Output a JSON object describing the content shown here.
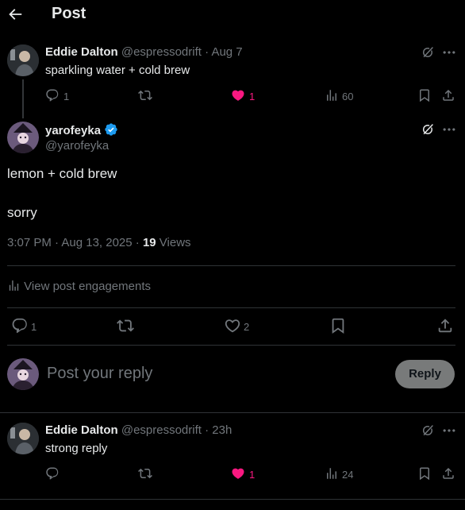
{
  "header": {
    "title": "Post",
    "back_icon": "arrow-left-icon"
  },
  "colors": {
    "background": "#000000",
    "text": "#e7e9ea",
    "muted": "#71767b",
    "like_active": "#f91880",
    "verified": "#1d9bf0",
    "reply_button_bg": "#787a7a"
  },
  "parent_post": {
    "display_name": "Eddie Dalton",
    "meta": "@espressodrift · Aug 7",
    "text": "sparkling water + cold brew",
    "replies": "1",
    "likes": "1",
    "views": "60"
  },
  "main_post": {
    "display_name": "yarofeyka",
    "handle": "@yarofeyka",
    "line1": "lemon + cold brew",
    "line2": "sorry",
    "timestamp": "3:07 PM · Aug 13, 2025 · ",
    "views_count": "19",
    "views_label": " Views",
    "engagements_label": "View post engagements",
    "replies": "1",
    "likes": "2"
  },
  "composer": {
    "placeholder": "Post your reply",
    "button_label": "Reply"
  },
  "reply_post": {
    "display_name": "Eddie Dalton",
    "meta": "@espressodrift · 23h",
    "text": "strong reply",
    "likes": "1",
    "views": "24"
  }
}
